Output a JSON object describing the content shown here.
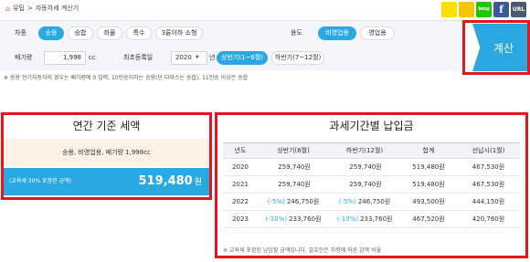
{
  "breadcrumb": {
    "home_icon": "home-icon",
    "items": [
      "유팁",
      ">",
      "자동차세 계산기"
    ]
  },
  "share": {
    "kakao": "",
    "story": "",
    "blog": "blog",
    "facebook": "f",
    "url": "URL"
  },
  "form": {
    "type_label": "차종",
    "types": [
      "승용",
      "승합",
      "화물",
      "특수",
      "3륜이하 소형"
    ],
    "use_label": "용도",
    "uses": [
      "비영업용",
      "영업용"
    ],
    "cc_label": "배기량",
    "cc_value": "1,998",
    "cc_unit": "cc",
    "reg_label": "최초등록일",
    "year_value": "2020",
    "year_unit": "년",
    "halves": [
      "상반기(1~6월)",
      "하반기(7~12월)"
    ],
    "calc_label": "계산"
  },
  "note": "※ 승용 전기자동차의 경우는 배기량에 0 입력, 10인승이하는 승용(단 다마스는 승합), 11인승 이상은 승합",
  "annual": {
    "title": "연간 기준 세액",
    "summary": "승용, 비영업용, 배기량 1,998cc",
    "bar_label": "(교육세 30% 포함된 금액)",
    "amount": "519,480",
    "unit": "원"
  },
  "period": {
    "title": "과세기간별 납입금",
    "headers": [
      "년도",
      "상반기(6월)",
      "하반기(12월)",
      "합계",
      "선납시(1월)"
    ],
    "rows": [
      {
        "year": "2020",
        "h1_cut": "",
        "h1": "259,740원",
        "h2_cut": "",
        "h2": "259,740원",
        "total": "519,480원",
        "prepay": "467,530원"
      },
      {
        "year": "2021",
        "h1_cut": "",
        "h1": "259,740원",
        "h2_cut": "",
        "h2": "259,740원",
        "total": "519,480원",
        "prepay": "467,530원"
      },
      {
        "year": "2022",
        "h1_cut": "(-5%)",
        "h1": "246,750원",
        "h2_cut": "(-5%)",
        "h2": "246,750원",
        "total": "493,500원",
        "prepay": "444,150원"
      },
      {
        "year": "2023",
        "h1_cut": "(-10%)",
        "h1": "233,760원",
        "h2_cut": "(-10%)",
        "h2": "233,760원",
        "total": "467,520원",
        "prepay": "420,760원"
      }
    ],
    "footnote": "※ 교육세 포함된 납입할 금액입니다. 괄호안은 차령에 따른 감액 비율"
  },
  "colors": {
    "accent": "#29a8e1",
    "highlight_border": "#e6141b",
    "summary_bg": "#fbf1e4"
  }
}
